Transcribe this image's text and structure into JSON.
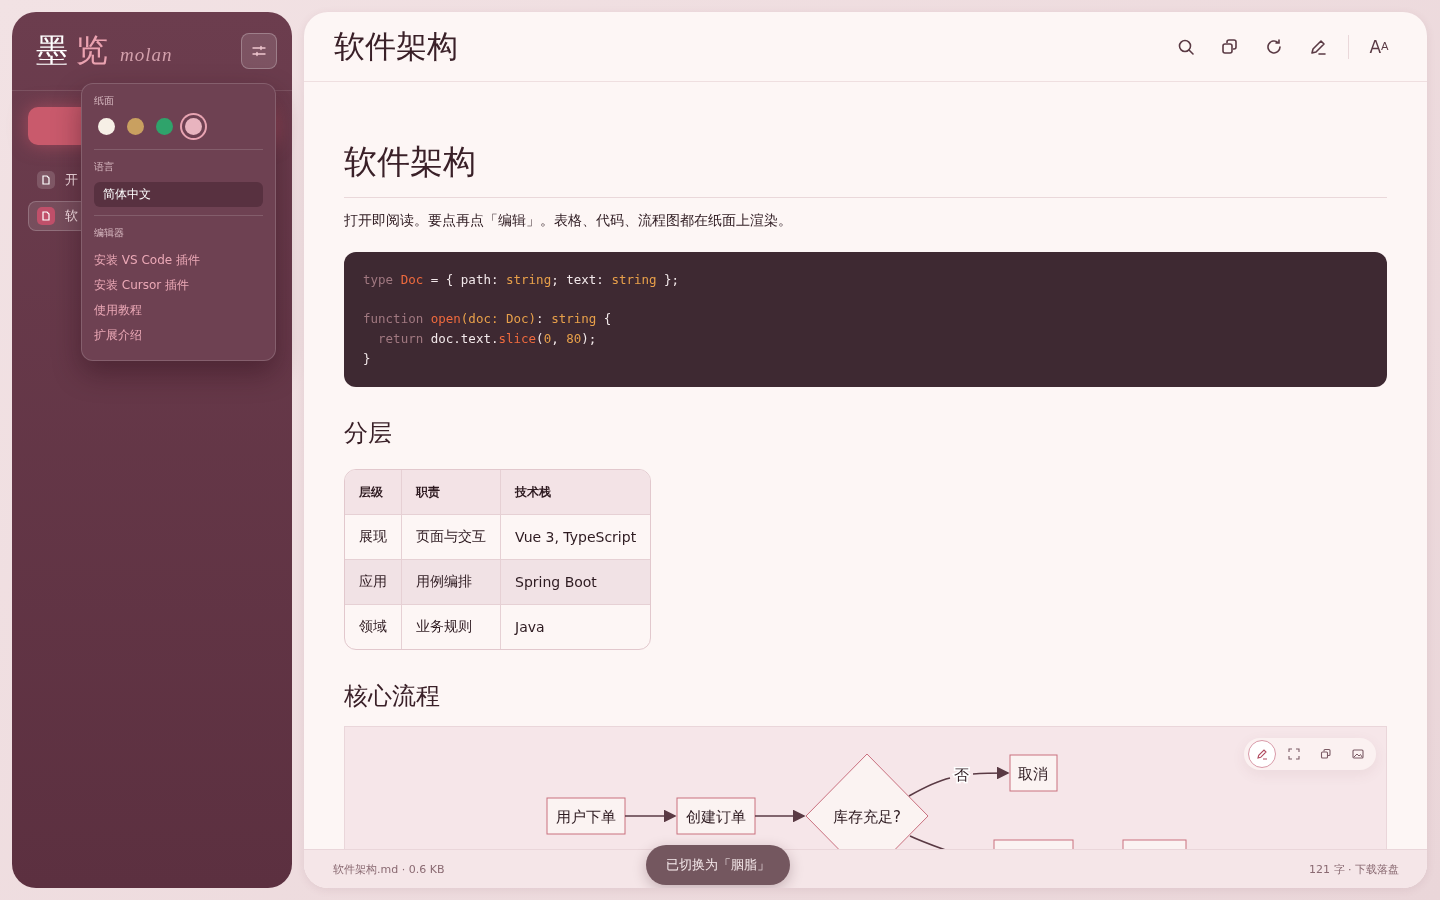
{
  "sidebar": {
    "logo": {
      "char_1": "墨",
      "char_2": "览",
      "latin": "molan"
    },
    "files": [
      {
        "label": "开",
        "selected": false
      },
      {
        "label": "软",
        "selected": true
      }
    ]
  },
  "popover": {
    "paper_label": "纸面",
    "papers": [
      {
        "color": "#f6efe6",
        "selected": false
      },
      {
        "color": "#c9a060",
        "selected": false
      },
      {
        "color": "#2fa36b",
        "selected": false
      },
      {
        "color": "#e8b4bf",
        "selected": true
      }
    ],
    "language_label": "语言",
    "language": "简体中文",
    "editor_label": "编辑器",
    "links": [
      "安装 VS Code 插件",
      "安装 Cursor 插件",
      "使用教程",
      "扩展介绍"
    ]
  },
  "header": {
    "title": "软件架构",
    "font_button": {
      "big": "A",
      "small": "A"
    }
  },
  "doc": {
    "title": "软件架构",
    "intro": "打开即阅读。要点再点「编辑」。表格、代码、流程图都在纸面上渲染。",
    "code": [
      [
        {
          "tokens": [
            {
              "t": "type ",
              "kind": "kw"
            },
            {
              "t": "Doc",
              "kind": "type"
            },
            {
              "t": " = { path: ",
              "kind": "plain"
            },
            {
              "t": "string",
              "kind": "str"
            },
            {
              "t": "; text: ",
              "kind": "plain"
            },
            {
              "t": "string",
              "kind": "str"
            },
            {
              "t": " };",
              "kind": "plain"
            }
          ]
        }
      ],
      [
        {
          "tokens": [
            {
              "t": "function ",
              "kind": "kw"
            },
            {
              "t": "open",
              "kind": "type"
            },
            {
              "t": "(doc: Doc)",
              "kind": "str"
            },
            {
              "t": ": ",
              "kind": "plain"
            },
            {
              "t": "string",
              "kind": "str"
            },
            {
              "t": " {",
              "kind": "plain"
            }
          ]
        },
        {
          "tokens": [
            {
              "t": "  return ",
              "kind": "kw"
            },
            {
              "t": "doc.text.",
              "kind": "plain"
            },
            {
              "t": "slice",
              "kind": "type"
            },
            {
              "t": "(",
              "kind": "plain"
            },
            {
              "t": "0",
              "kind": "str"
            },
            {
              "t": ", ",
              "kind": "plain"
            },
            {
              "t": "80",
              "kind": "str"
            },
            {
              "t": ");",
              "kind": "plain"
            }
          ]
        },
        {
          "tokens": [
            {
              "t": "}",
              "kind": "plain"
            }
          ]
        }
      ]
    ],
    "section_1": "分层",
    "table": {
      "columns": [
        "层级",
        "职责",
        "技术栈"
      ],
      "rows": [
        [
          "展现",
          "页面与交互",
          "Vue 3, TypeScript"
        ],
        [
          "应用",
          "用例编排",
          "Spring Boot"
        ],
        [
          "领域",
          "业务规则",
          "Java"
        ]
      ]
    },
    "section_2": "核心流程",
    "flow": {
      "nodes": [
        "用户下单",
        "创建订单",
        "库存充足?",
        "取消"
      ],
      "edge_label": "否"
    }
  },
  "status": {
    "left": "软件架构.md · 0.6 KB",
    "right": "121 字 · 下载落盘"
  },
  "toast": "已切换为「胭脂」"
}
